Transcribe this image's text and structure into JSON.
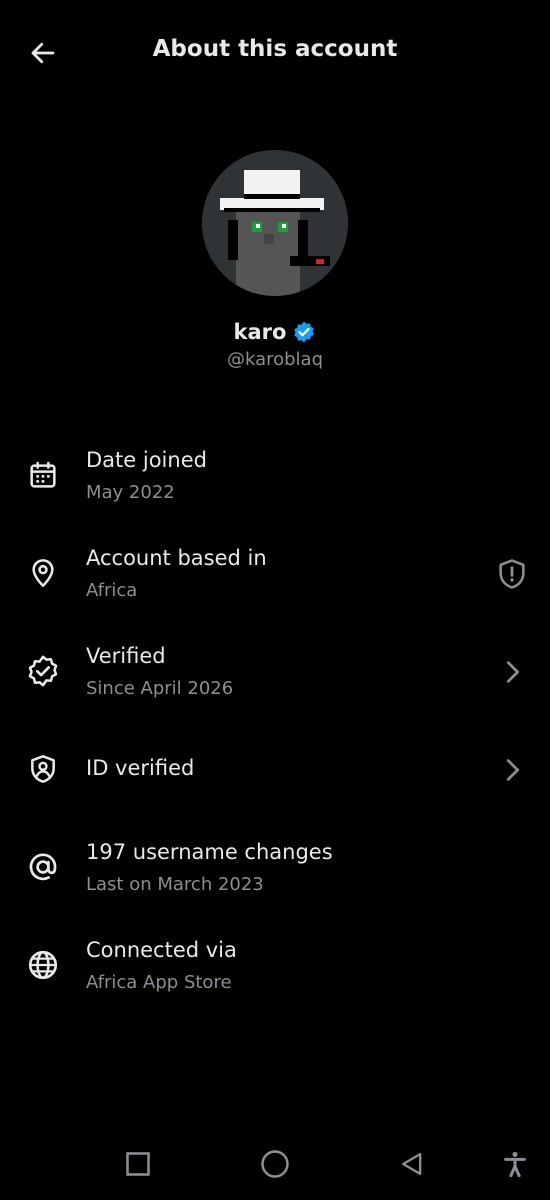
{
  "header": {
    "title": "About this account"
  },
  "profile": {
    "name": "karo",
    "handle": "@karoblaq"
  },
  "rows": [
    {
      "label": "Date joined",
      "sub": "May 2022",
      "icon": "calendar-icon"
    },
    {
      "label": "Account based in",
      "sub": "Africa",
      "icon": "location-pin-icon",
      "trailing_icon": "shield-alert-icon"
    },
    {
      "label": "Verified",
      "sub": "Since April 2026",
      "icon": "verified-badge-icon",
      "trailing_icon": "chevron-right-icon"
    },
    {
      "label": "ID verified",
      "icon": "id-shield-icon",
      "trailing_icon": "chevron-right-icon"
    },
    {
      "label": "197 username changes",
      "sub": "Last on March 2023",
      "icon": "at-sign-icon"
    },
    {
      "label": "Connected via",
      "sub": "Africa App Store",
      "icon": "globe-icon"
    }
  ],
  "colors": {
    "background": "#000000",
    "text": "#e7e9ea",
    "secondary": "#8b8f93",
    "verified_blue": "#1d9bf0"
  }
}
